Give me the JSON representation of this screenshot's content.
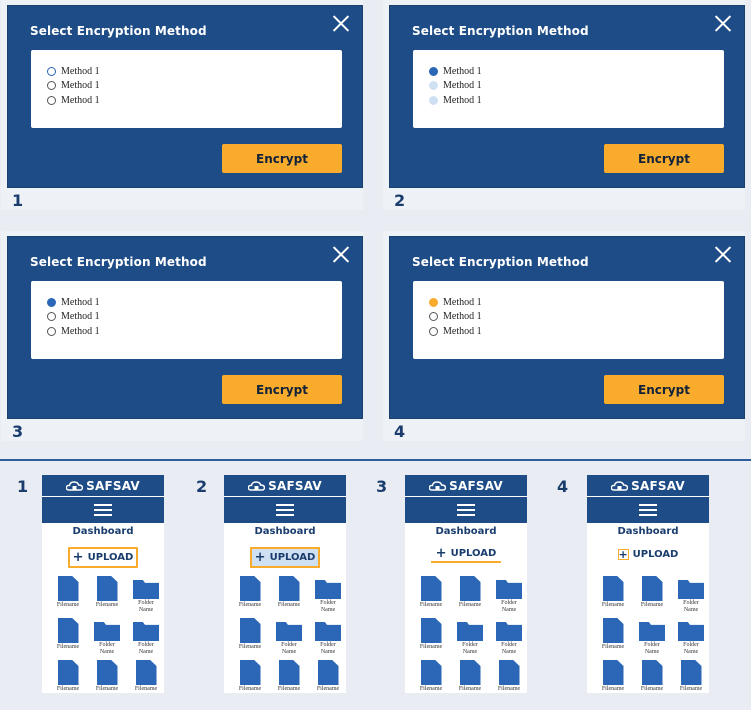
{
  "dialogs": [
    {
      "number": "1",
      "title": "Select Encryption Method",
      "options": [
        "Method 1",
        "Method 1",
        "Method 1"
      ],
      "button": "Encrypt"
    },
    {
      "number": "2",
      "title": "Select Encryption Method",
      "options": [
        "Method 1",
        "Method 1",
        "Method 1"
      ],
      "button": "Encrypt"
    },
    {
      "number": "3",
      "title": "Select Encryption Method",
      "options": [
        "Method 1",
        "Method 1",
        "Method 1"
      ],
      "button": "Encrypt"
    },
    {
      "number": "4",
      "title": "Select Encryption Method",
      "options": [
        "Method 1",
        "Method 1",
        "Method 1"
      ],
      "button": "Encrypt"
    }
  ],
  "mobiles": [
    {
      "number": "1",
      "logo": "SAFSAV",
      "heading": "Dashboard",
      "upload": "UPLOAD"
    },
    {
      "number": "2",
      "logo": "SAFSAV",
      "heading": "Dashboard",
      "upload": "UPLOAD"
    },
    {
      "number": "3",
      "logo": "SAFSAV",
      "heading": "Dashboard",
      "upload": "UPLOAD"
    },
    {
      "number": "4",
      "logo": "SAFSAV",
      "heading": "Dashboard",
      "upload": "UPLOAD"
    }
  ],
  "files": {
    "filename": "Filename",
    "folder_line1": "Folder",
    "folder_line2": "Name"
  },
  "colors": {
    "primary": "#1e4c86",
    "accent": "#f9ab2c",
    "selected": "#2b66b7",
    "disabled": "#cfe0f3"
  },
  "icons": {
    "close": "close-icon",
    "logo": "cloud-lock-icon",
    "menu": "hamburger-menu-icon",
    "upload": "plus-icon",
    "file": "file-icon",
    "folder": "folder-icon"
  }
}
